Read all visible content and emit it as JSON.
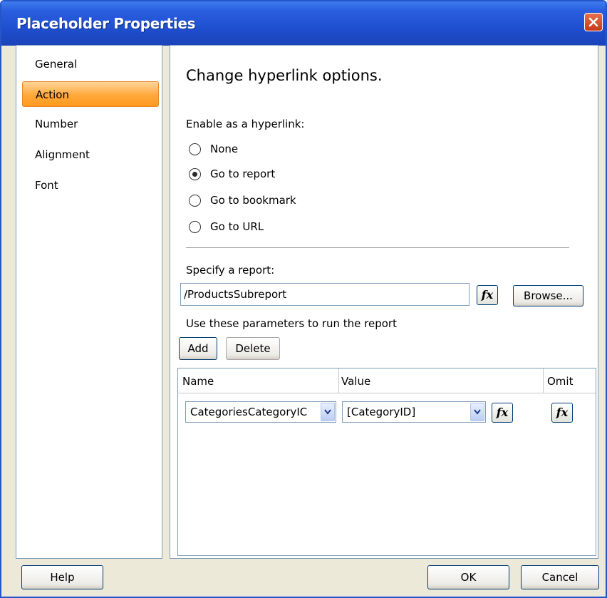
{
  "window": {
    "title": "Placeholder Properties"
  },
  "nav": {
    "items": [
      "General",
      "Action",
      "Number",
      "Alignment",
      "Font"
    ],
    "active_index": 1
  },
  "main": {
    "heading": "Change hyperlink options.",
    "enable_label": "Enable as a hyperlink:",
    "radios": [
      {
        "label": "None",
        "checked": false
      },
      {
        "label": "Go to report",
        "checked": true
      },
      {
        "label": "Go to bookmark",
        "checked": false
      },
      {
        "label": "Go to URL",
        "checked": false
      }
    ],
    "report_label": "Specify a report:",
    "report_value": "/ProductsSubreport",
    "fx_label": "fx",
    "browse_label": "Browse...",
    "params_label": "Use these parameters to run the report",
    "add_label": "Add",
    "delete_label": "Delete",
    "grid": {
      "headers": {
        "name": "Name",
        "value": "Value",
        "omit": "Omit"
      },
      "rows": [
        {
          "name": "CategoriesCategoryIC",
          "value": "[CategoryID]"
        }
      ]
    }
  },
  "footer": {
    "help_label": "Help",
    "ok_label": "OK",
    "cancel_label": "Cancel"
  },
  "colors": {
    "titlebar": "#1f4fcf",
    "active_nav": "#ffa83a",
    "dialog_bg": "#ece9d8"
  }
}
